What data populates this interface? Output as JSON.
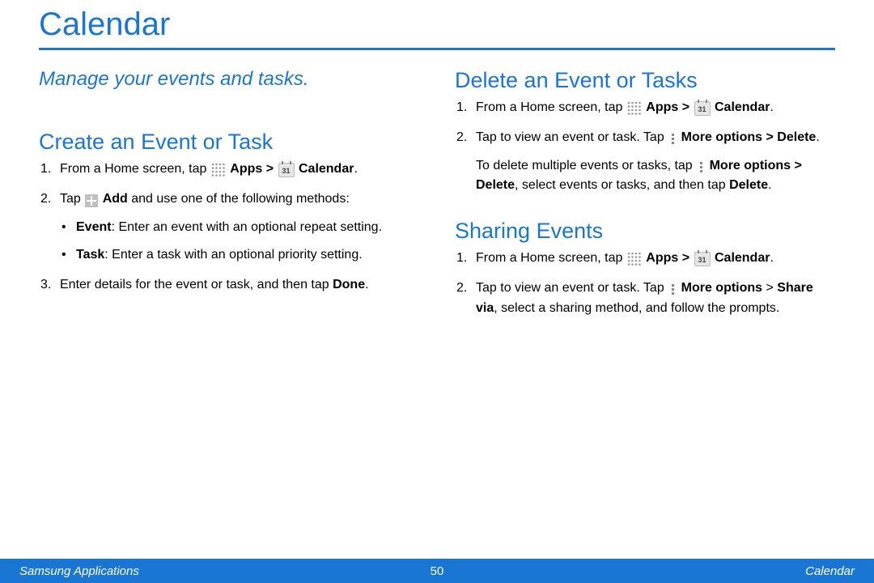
{
  "title": "Calendar",
  "subtitle": "Manage your events and tasks.",
  "left": {
    "sec1": {
      "heading": "Create an Event or Task",
      "step1_a": "From a Home screen, tap ",
      "step1_apps": "Apps",
      "step1_gt": " > ",
      "step1_cal": "Calendar",
      "step1_end": ".",
      "step2_a": "Tap ",
      "step2_add": "Add",
      "step2_b": " and use one of the following methods:",
      "bullet1_b": "Event",
      "bullet1_t": ": Enter an event with an optional repeat setting.",
      "bullet2_b": "Task",
      "bullet2_t": ": Enter a task with an optional priority setting.",
      "step3_a": "Enter details for the event or task, and then tap ",
      "step3_done": "Done",
      "step3_end": "."
    }
  },
  "right": {
    "sec1": {
      "heading": "Delete an Event or Tasks",
      "step1_a": "From a Home screen, tap ",
      "step1_apps": "Apps",
      "step1_gt": " > ",
      "step1_cal": "Calendar",
      "step1_end": ".",
      "step2_a": "Tap to view an event or task. Tap ",
      "step2_more": "More options > Delete",
      "step2_end": ".",
      "para_a": "To delete multiple events or tasks, tap ",
      "para_more": "More options > Delete",
      "para_b": ", select events or tasks, and then tap ",
      "para_del": "Delete",
      "para_end": "."
    },
    "sec2": {
      "heading": "Sharing Events",
      "step1_a": "From a Home screen, tap ",
      "step1_apps": "Apps",
      "step1_gt": " > ",
      "step1_cal": "Calendar",
      "step1_end": ".",
      "step2_a": "Tap to view an event or task. Tap ",
      "step2_more": "More options",
      "step2_gt": " > ",
      "step2_share": "Share via",
      "step2_b": ", select a sharing method, and follow the prompts."
    }
  },
  "icons": {
    "calendar_day": "31"
  },
  "footer": {
    "left": "Samsung Applications",
    "page": "50",
    "right": "Calendar"
  }
}
